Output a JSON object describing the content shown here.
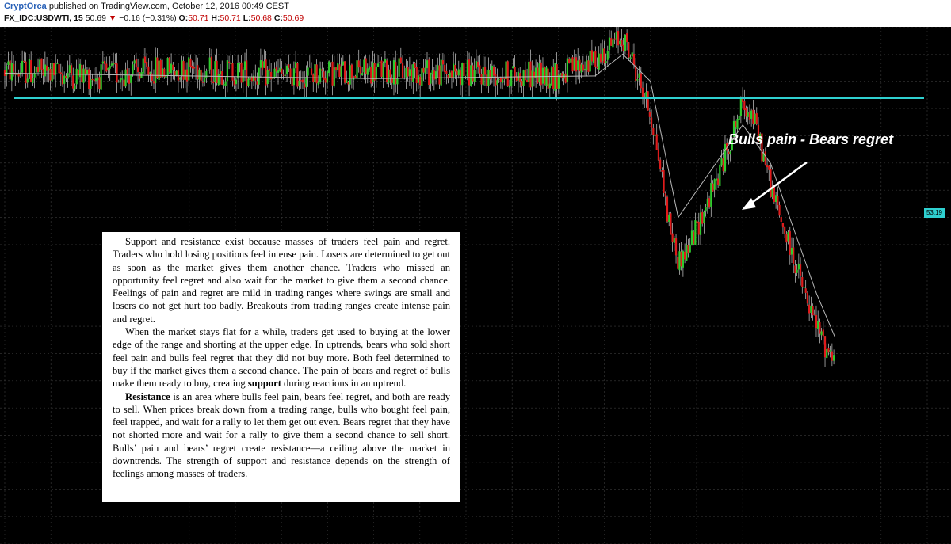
{
  "header": {
    "author": "CryptOrca",
    "published": " published on TradingView.com, October 12, 2016 00:49 CEST",
    "symbol": "FX_IDC:USDWTI, 15",
    "last": "50.69",
    "arrow": "▼",
    "change": "−0.16 (−0.31%)",
    "o_label": "O:",
    "o_value": "50.71",
    "h_label": "H:",
    "h_value": "50.71",
    "l_label": "L:",
    "l_value": "50.68",
    "c_label": "C:",
    "c_value": "50.69"
  },
  "annotation": "Bulls pain - Bears regret",
  "price_tag": "53.19",
  "colors": {
    "background": "#000000",
    "grid": "#3a3a3a",
    "up": "#2ecc2e",
    "down": "#e01b1b",
    "wick": "#cfcfcf",
    "level_line": "#2fd0d0",
    "ma": "#b8b8b8"
  },
  "book_text": {
    "p1": "Support and resistance exist because masses of traders feel pain and regret. Traders who hold losing positions feel intense pain. Losers are determined to get out as soon as the market gives them another chance. Traders who missed an opportunity feel regret and also wait for the market to give them a second chance. Feelings of pain and regret are mild in trading ranges where swings are small and losers do not get hurt too badly. Breakouts from trading ranges create intense pain and regret.",
    "p2_start": "When the market stays flat for a while, traders get used to buying at the lower edge of the range and shorting at the upper edge. In uptrends, bears who sold short feel pain and bulls feel regret that they did not buy more. Both feel determined to buy if the market gives them a second chance. The pain of bears and regret of bulls make them ready to buy, creating ",
    "p2_bold": "support",
    "p2_end": " during reactions in an uptrend.",
    "p3_bold": "Resistance",
    "p3_rest": " is an area where bulls feel pain, bears feel regret, and both are ready to sell. When prices break down from a trading range, bulls who bought feel pain, feel trapped, and wait for a rally to let them get out even. Bears regret that they have not shorted more and wait for a rally to give them a second chance to sell short. Bulls’ pain and bears’ regret create resistance—a ceiling above the market in downtrends. The strength of support and resistance depends on the strength of feelings among masses of traders."
  },
  "chart_data": {
    "type": "candlestick",
    "ylim": [
      45.0,
      54.5
    ],
    "level": 53.19,
    "grid": true,
    "x_count": 100,
    "close_path": [
      [
        0,
        53.7
      ],
      [
        10,
        53.6
      ],
      [
        20,
        53.75
      ],
      [
        30,
        53.6
      ],
      [
        40,
        53.7
      ],
      [
        50,
        53.65
      ],
      [
        60,
        53.6
      ],
      [
        64,
        53.9
      ],
      [
        66,
        54.2
      ],
      [
        67,
        54.3
      ],
      [
        68,
        53.9
      ],
      [
        69,
        53.4
      ],
      [
        70,
        52.9
      ],
      [
        71,
        52.0
      ],
      [
        72,
        50.9
      ],
      [
        73,
        50.2
      ],
      [
        74,
        50.4
      ],
      [
        75,
        50.8
      ],
      [
        76,
        51.2
      ],
      [
        77,
        51.6
      ],
      [
        78,
        52.1
      ],
      [
        79,
        52.6
      ],
      [
        80,
        53.1
      ],
      [
        81,
        52.9
      ],
      [
        82,
        52.3
      ],
      [
        83,
        51.6
      ],
      [
        84,
        51.0
      ],
      [
        85,
        50.5
      ],
      [
        86,
        50.0
      ],
      [
        87,
        49.4
      ],
      [
        88,
        49.0
      ],
      [
        89,
        48.6
      ],
      [
        90,
        48.5
      ]
    ],
    "ma_path": [
      [
        0,
        53.65
      ],
      [
        40,
        53.55
      ],
      [
        64,
        53.6
      ],
      [
        67,
        54.0
      ],
      [
        70,
        53.5
      ],
      [
        73,
        51.0
      ],
      [
        80,
        52.7
      ],
      [
        83,
        52.0
      ],
      [
        88,
        49.6
      ],
      [
        90,
        48.8
      ]
    ]
  }
}
